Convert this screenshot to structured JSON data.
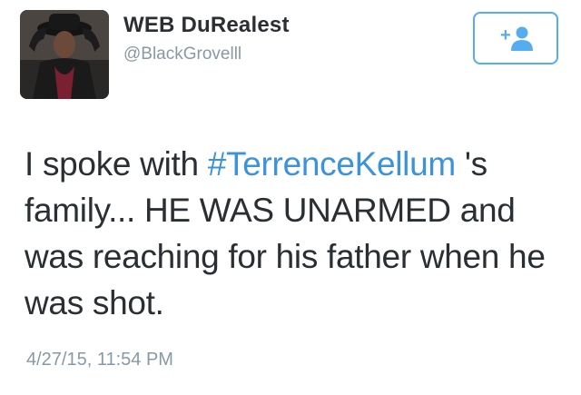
{
  "tweet": {
    "author": {
      "display_name": "WEB DuRealest",
      "handle": "@BlackGrovelll"
    },
    "follow_button": {
      "icon": "add-user-icon",
      "glyph": "+"
    },
    "text": {
      "before": "I spoke with ",
      "hashtag": "#TerrenceKellum",
      "after": " 's family... HE WAS UNARMED and was reaching for his father when he was shot."
    },
    "timestamp": "4/27/15, 11:54 PM"
  },
  "colors": {
    "accent": "#55acee",
    "hashtag": "#3b94d9",
    "text": "#292f33",
    "muted": "#8899a6"
  }
}
